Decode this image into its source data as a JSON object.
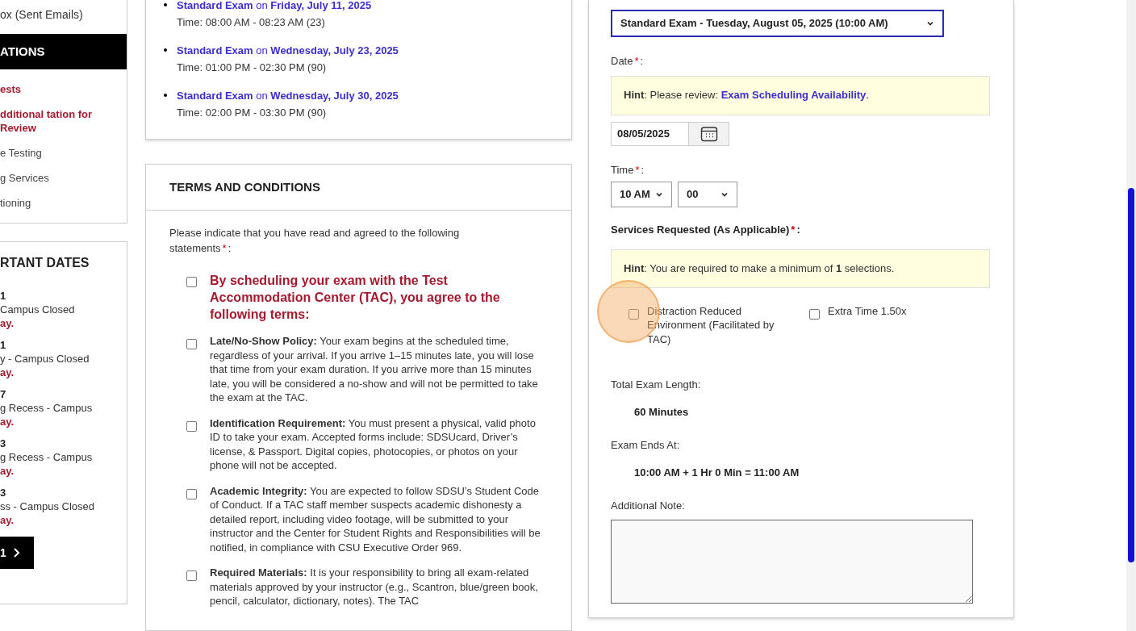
{
  "sidebar": {
    "inbox_link": "ox (Sent Emails)",
    "section_title": "ATIONS",
    "items": [
      {
        "label": "ests",
        "kind": "highlight"
      },
      {
        "label": "dditional tation for Review",
        "kind": "highlight"
      },
      {
        "label": "e Testing",
        "kind": "plain"
      },
      {
        "label": "g Services",
        "kind": "plain"
      },
      {
        "label": "tioning",
        "kind": "plain"
      }
    ]
  },
  "important_dates": {
    "title": "RTANT DATES",
    "entries": [
      {
        "date": "1",
        "event": "Campus Closed",
        "note": "ay."
      },
      {
        "date": "1",
        "event": "y - Campus Closed",
        "note": "ay."
      },
      {
        "date": "7",
        "event": "g Recess - Campus",
        "note": "ay."
      },
      {
        "date": "3",
        "event": "g Recess - Campus",
        "note": "ay."
      },
      {
        "date": "3",
        "event": "ss - Campus Closed",
        "note": "ay."
      }
    ],
    "pager": {
      "page": "1"
    }
  },
  "scheduled_exams": [
    {
      "title": "**Standard Exam** on **Friday, July 11, 2025**",
      "time": "Time: 08:00 AM - 08:23 AM (23)"
    },
    {
      "title": "**Standard Exam** on **Wednesday, July 23, 2025**",
      "time": "Time: 01:00 PM - 02:30 PM (90)"
    },
    {
      "title": "**Standard Exam** on **Wednesday, July 30, 2025**",
      "time": "Time: 02:00 PM - 03:30 PM (90)"
    }
  ],
  "terms": {
    "title": "TERMS AND CONDITIONS",
    "intro": "Please indicate that you have read and agreed to the following statements",
    "required_mark": "*",
    "colon": ":",
    "items": [
      {
        "kind": "heading",
        "checked": false,
        "text": "**By scheduling your exam with the Test Accommodation Center (TAC), you agree to the following terms:**"
      },
      {
        "kind": "term",
        "checked": false,
        "text": "**Late/No-Show Policy:** Your exam begins at the scheduled time, regardless of your arrival. If you arrive 1–15 minutes late, you will lose that time from your exam duration. If you arrive more than 15 minutes late, you will be considered a no-show and will not be permitted to take the exam at the TAC."
      },
      {
        "kind": "term",
        "checked": false,
        "text": "**Identification Requirement:** You must present a physical, valid photo ID to take your exam. Accepted forms include: SDSUcard, Driver’s license, & Passport. Digital copies, photocopies, or photos on your phone will not be accepted."
      },
      {
        "kind": "term",
        "checked": false,
        "text": "**Academic Integrity:** You are expected to follow SDSU’s Student Code of Conduct. If a TAC staff member suspects academic dishonesty a detailed report, including video footage, will be submitted to your instructor and the Center for Student Rights and Responsibilities will be notified, in compliance with CSU Executive Order 969."
      },
      {
        "kind": "term",
        "checked": false,
        "text": "**Required Materials:** It is your responsibility to bring all exam-related materials approved by your instructor (e.g., Scantron, blue/green book, pencil, calculator, dictionary, notes). The TAC"
      }
    ]
  },
  "form": {
    "exam_date_select": {
      "value": "Standard Exam - Tuesday, August 05, 2025 (10:00 AM)",
      "focused": true
    },
    "date": {
      "label": "Date",
      "required_mark": "*",
      "colon": ":",
      "hint": {
        "prefix": "**Hint**: Please review: ",
        "link": "Exam Scheduling Availability",
        "suffix": "."
      },
      "value": "08/05/2025"
    },
    "time": {
      "label": "Time",
      "required_mark": "*",
      "colon": ":",
      "hour": "10 AM",
      "minute": "00"
    },
    "services": {
      "label": "Services Requested (As Applicable)",
      "required_mark": "*",
      "colon": ":",
      "hint": "**Hint**: You are required to make a minimum of **1** selections.",
      "options": [
        {
          "label": "Distraction Reduced Environment (Facilitated by TAC)",
          "checked": false
        },
        {
          "label": "Extra Time 1.50x",
          "checked": false
        }
      ]
    },
    "total_length": {
      "label": "Total Exam Length:",
      "value": "60 Minutes"
    },
    "ends_at": {
      "label": "Exam Ends At:",
      "value": "10:00 AM + 1 Hr 0 Min = 11:00 AM"
    },
    "note": {
      "label": "Additional Note:"
    }
  }
}
